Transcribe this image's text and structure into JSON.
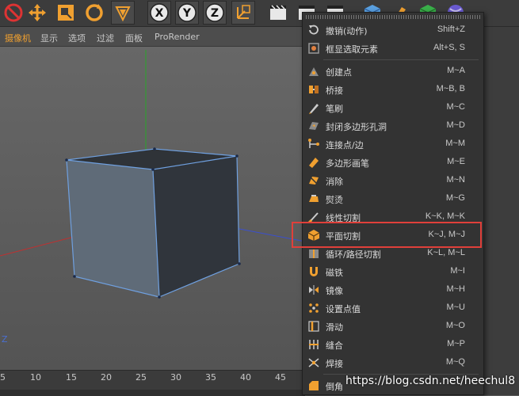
{
  "colors": {
    "accent": "#f0a030",
    "highlight_box": "#e0403a",
    "axis_x": "#c03030",
    "axis_y": "#2aa52a",
    "axis_z": "#3a4fd0",
    "cube_edge": "#6fa0e0"
  },
  "toolbar": {
    "icons": [
      "undo-icon",
      "move-icon",
      "scale-icon",
      "rotate-icon",
      "model-mode-icon",
      "x-axis-lock-icon",
      "y-axis-lock-icon",
      "z-axis-lock-icon",
      "coordinate-system-icon",
      "render-view-icon",
      "render-active-icon",
      "render-settings-icon",
      "cube-primitive-icon",
      "pen-spline-icon",
      "subdivision-icon",
      "deformer-icon"
    ],
    "x_label": "X",
    "y_label": "Y",
    "z_label": "Z"
  },
  "viewport_menu": {
    "items": [
      "摄像机",
      "显示",
      "选项",
      "过滤",
      "面板",
      "ProRender"
    ]
  },
  "viewport": {
    "axis_label": "Z"
  },
  "timeline": {
    "ticks": [
      "5",
      "10",
      "15",
      "20",
      "25",
      "30",
      "35",
      "40",
      "45"
    ]
  },
  "menu": {
    "items": [
      {
        "label": "撤销(动作)",
        "shortcut": "Shift+Z",
        "icon": "undo-action-icon"
      },
      {
        "label": "框显选取元素",
        "shortcut": "Alt+S, S",
        "icon": "frame-selected-icon"
      },
      {
        "label": "创建点",
        "shortcut": "M~A",
        "icon": "create-point-icon"
      },
      {
        "label": "桥接",
        "shortcut": "M~B, B",
        "icon": "bridge-icon"
      },
      {
        "label": "笔刷",
        "shortcut": "M~C",
        "icon": "brush-icon"
      },
      {
        "label": "封闭多边形孔洞",
        "shortcut": "M~D",
        "icon": "close-polygon-hole-icon"
      },
      {
        "label": "连接点/边",
        "shortcut": "M~M",
        "icon": "connect-points-edges-icon"
      },
      {
        "label": "多边形画笔",
        "shortcut": "M~E",
        "icon": "polygon-pen-icon"
      },
      {
        "label": "消除",
        "shortcut": "M~N",
        "icon": "dissolve-icon"
      },
      {
        "label": "熨烫",
        "shortcut": "M~G",
        "icon": "iron-icon"
      },
      {
        "label": "线性切割",
        "shortcut": "K~K, M~K",
        "icon": "line-cut-icon"
      },
      {
        "label": "平面切割",
        "shortcut": "K~J, M~J",
        "icon": "plane-cut-icon"
      },
      {
        "label": "循环/路径切割",
        "shortcut": "K~L, M~L",
        "icon": "loop-path-cut-icon"
      },
      {
        "label": "磁铁",
        "shortcut": "M~I",
        "icon": "magnet-icon"
      },
      {
        "label": "镜像",
        "shortcut": "M~H",
        "icon": "mirror-icon"
      },
      {
        "label": "设置点值",
        "shortcut": "M~U",
        "icon": "set-point-value-icon"
      },
      {
        "label": "滑动",
        "shortcut": "M~O",
        "icon": "slide-icon"
      },
      {
        "label": "缝合",
        "shortcut": "M~P",
        "icon": "stitch-icon"
      },
      {
        "label": "焊接",
        "shortcut": "M~Q",
        "icon": "weld-icon"
      },
      {
        "label": "倒角",
        "shortcut": "",
        "icon": "bevel-icon"
      }
    ]
  },
  "watermark": "https://blog.csdn.net/heechul8"
}
